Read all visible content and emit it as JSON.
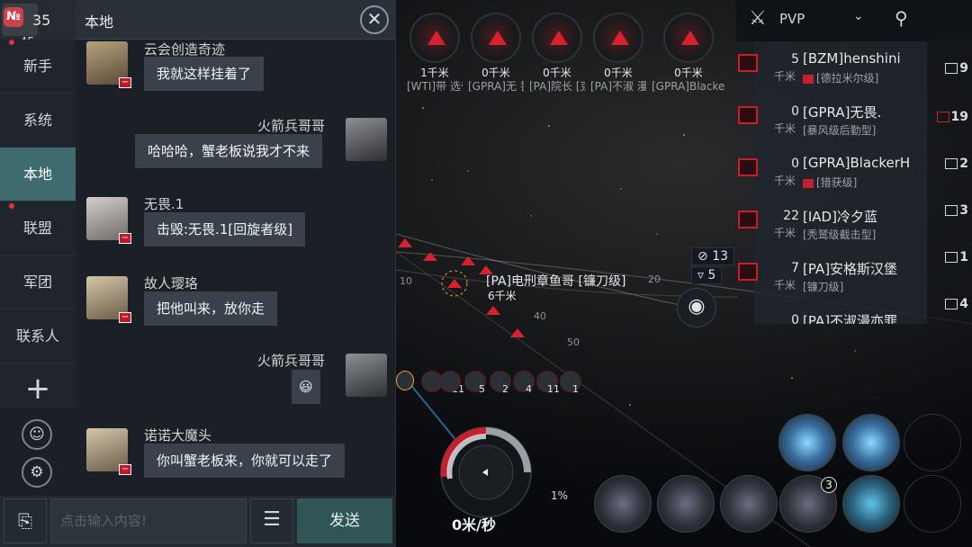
{
  "top_left": {
    "unread_icon_label": "№",
    "unread_count": "35",
    "sub_count": "45"
  },
  "chat": {
    "title": "本地",
    "close_glyph": "✕",
    "sidebar": [
      {
        "label": "新手"
      },
      {
        "label": "系统"
      },
      {
        "label": "本地"
      },
      {
        "label": "联盟"
      },
      {
        "label": "军团"
      },
      {
        "label": "联系人"
      }
    ],
    "plus_glyph": "+",
    "messages": [
      {
        "name": "云会创造奇迹",
        "text": "我就这样挂着了",
        "side": "left"
      },
      {
        "name": "火箭兵哥哥",
        "text": "哈哈哈，蟹老板说我才不来",
        "side": "right"
      },
      {
        "name": "无畏.1",
        "text": "击毁:无畏.1[回旋者级]",
        "side": "left"
      },
      {
        "name": "故人璎珞",
        "text": "把他叫来，放你走",
        "side": "left"
      },
      {
        "name": "火箭兵哥哥",
        "text": "😃",
        "side": "right"
      },
      {
        "name": "诺诺大魔头",
        "text": "你叫蟹老板来，你就可以走了",
        "side": "left"
      }
    ],
    "input_placeholder": "点击输入内容!",
    "menu_glyph": "☰",
    "send_label": "发送"
  },
  "targets": [
    {
      "dist": "1千米",
      "name": "[WTI]带 选帝侯["
    },
    {
      "dist": "0千米",
      "name": "[GPRA]无 畏.[暴风"
    },
    {
      "dist": "0千米",
      "name": "[PA]院长 [克鲁沃"
    },
    {
      "dist": "0千米",
      "name": "[PA]不淑 漫亦罪名"
    },
    {
      "dist": "0千米",
      "name": "[GPRA]BlackerH [猎获级]"
    }
  ],
  "overview": {
    "tab_label": "PVP",
    "rows": [
      {
        "dist": "5",
        "unit": "千米",
        "name": "[BZM]henshini",
        "ship": "[德拉米尔级]"
      },
      {
        "dist": "0",
        "unit": "千米",
        "name": "[GPRA]无畏.",
        "ship": "[暴风级后勤型]"
      },
      {
        "dist": "0",
        "unit": "千米",
        "name": "[GPRA]BlackerH",
        "ship": "[猎获级]"
      },
      {
        "dist": "22",
        "unit": "千米",
        "name": "[IAD]冷夕蓝",
        "ship": "[秃鹫级截击型]"
      },
      {
        "dist": "7",
        "unit": "千米",
        "name": "[PA]安格斯汉堡",
        "ship": "[镰刀级]"
      },
      {
        "dist": "0",
        "unit": "千米",
        "name": "[PA]不淑漫亦罪",
        "ship": ""
      }
    ],
    "counts": [
      "9",
      "19",
      "2",
      "3",
      "1",
      "4"
    ]
  },
  "hud": {
    "hostile_count": "13",
    "neutral_count": "5",
    "target_label": "[PA]电刑章鱼哥 [镰刀级]",
    "target_dist": "6千米",
    "scale_marks": [
      "10",
      "20",
      "40",
      "50"
    ],
    "drones": [
      "11",
      "5",
      "2",
      "4",
      "11",
      "1"
    ],
    "speed": "0米/秒",
    "speed_pct": "1%",
    "module_count": "3"
  }
}
